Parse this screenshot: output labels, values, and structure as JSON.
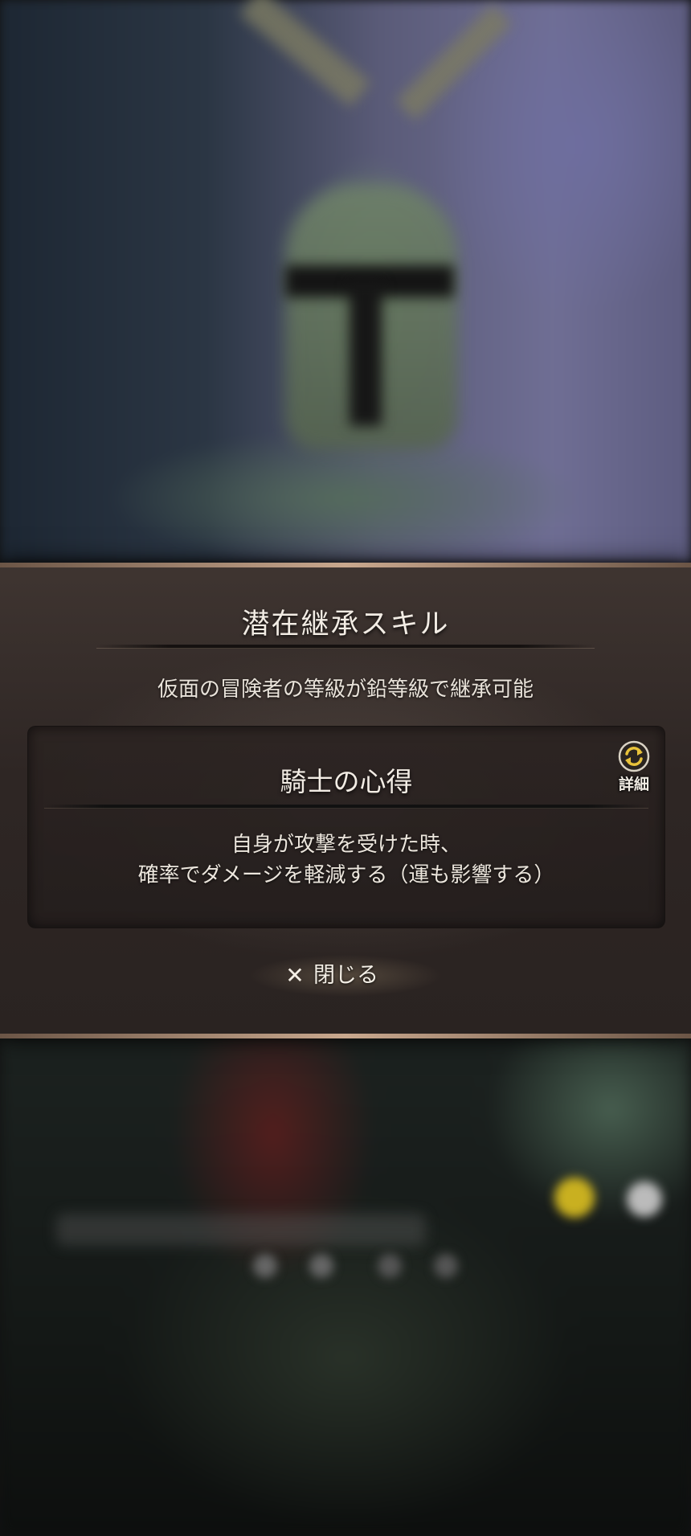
{
  "dialog": {
    "title": "潜在継承スキル",
    "subtitle": "仮面の冒険者の等級が鉛等級で継承可能",
    "skill": {
      "name": "騎士の心得",
      "description_line1": "自身が攻撃を受けた時、",
      "description_line2": "確率でダメージを軽減する（運も影響する）",
      "detail_label": "詳細",
      "detail_icon": "refresh-icon"
    },
    "close_icon": "close-icon",
    "close_glyph": "✕",
    "close_label": "閉じる"
  },
  "colors": {
    "panel": "#2e2624",
    "border_accent": "#c9a88e",
    "text": "#f2ece4"
  }
}
